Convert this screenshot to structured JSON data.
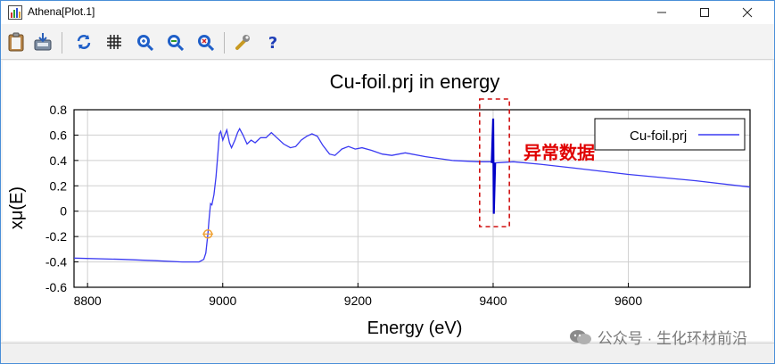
{
  "window": {
    "title": "Athena[Plot.1]"
  },
  "title_controls": {
    "minimize_icon": "minimize-icon",
    "maximize_icon": "maximize-icon",
    "close_icon": "close-icon"
  },
  "toolbar": {
    "buttons": [
      {
        "name": "copy-button",
        "icon": "clipboard-icon"
      },
      {
        "name": "save-button",
        "icon": "save-icon"
      },
      {
        "name": "refresh-button",
        "icon": "refresh-icon"
      },
      {
        "name": "grid-button",
        "icon": "grid-icon"
      },
      {
        "name": "zoom-in-button",
        "icon": "zoom-in-icon"
      },
      {
        "name": "zoom-out-button",
        "icon": "zoom-out-icon"
      },
      {
        "name": "zoom-reset-button",
        "icon": "zoom-reset-icon"
      },
      {
        "name": "settings-button",
        "icon": "wrench-icon"
      },
      {
        "name": "help-button",
        "icon": "help-icon"
      }
    ]
  },
  "annotation": {
    "text": "异常数据",
    "color": "#e00000"
  },
  "watermark": {
    "text": "公众号 · 生化环材前沿"
  },
  "colors": {
    "series": "#3a3af2",
    "spike": "#0000c8",
    "marker": "#f0a030",
    "annotation": "#e00000"
  },
  "chart_data": {
    "type": "line",
    "title": "Cu-foil.prj in energy",
    "xlabel": "Energy (eV)",
    "ylabel": "xμ(E)",
    "xlim": [
      8780,
      9780
    ],
    "ylim": [
      -0.6,
      0.8
    ],
    "x_ticks": [
      8800,
      9000,
      9200,
      9400,
      9600
    ],
    "y_ticks": [
      -0.6,
      -0.4,
      -0.2,
      0,
      0.2,
      0.4,
      0.6,
      0.8
    ],
    "grid": true,
    "legend": {
      "position": "top-right",
      "entries": [
        "Cu-foil.prj"
      ]
    },
    "series": [
      {
        "name": "Cu-foil.prj",
        "points": [
          [
            8780,
            -0.37
          ],
          [
            8850,
            -0.38
          ],
          [
            8900,
            -0.39
          ],
          [
            8940,
            -0.4
          ],
          [
            8965,
            -0.4
          ],
          [
            8972,
            -0.38
          ],
          [
            8975,
            -0.33
          ],
          [
            8978,
            -0.18
          ],
          [
            8980,
            -0.05
          ],
          [
            8982,
            0.06
          ],
          [
            8984,
            0.05
          ],
          [
            8987,
            0.13
          ],
          [
            8990,
            0.27
          ],
          [
            8993,
            0.47
          ],
          [
            8995,
            0.61
          ],
          [
            8997,
            0.63
          ],
          [
            9000,
            0.56
          ],
          [
            9003,
            0.6
          ],
          [
            9006,
            0.64
          ],
          [
            9010,
            0.54
          ],
          [
            9013,
            0.5
          ],
          [
            9018,
            0.56
          ],
          [
            9022,
            0.62
          ],
          [
            9025,
            0.65
          ],
          [
            9030,
            0.6
          ],
          [
            9036,
            0.53
          ],
          [
            9042,
            0.56
          ],
          [
            9048,
            0.54
          ],
          [
            9056,
            0.58
          ],
          [
            9064,
            0.58
          ],
          [
            9072,
            0.62
          ],
          [
            9080,
            0.58
          ],
          [
            9090,
            0.53
          ],
          [
            9100,
            0.5
          ],
          [
            9108,
            0.51
          ],
          [
            9116,
            0.56
          ],
          [
            9124,
            0.59
          ],
          [
            9132,
            0.61
          ],
          [
            9140,
            0.59
          ],
          [
            9148,
            0.52
          ],
          [
            9158,
            0.45
          ],
          [
            9166,
            0.44
          ],
          [
            9176,
            0.49
          ],
          [
            9186,
            0.51
          ],
          [
            9196,
            0.49
          ],
          [
            9206,
            0.5
          ],
          [
            9220,
            0.48
          ],
          [
            9236,
            0.45
          ],
          [
            9250,
            0.44
          ],
          [
            9270,
            0.46
          ],
          [
            9300,
            0.43
          ],
          [
            9340,
            0.4
          ],
          [
            9380,
            0.39
          ],
          [
            9396,
            0.39
          ],
          [
            9400,
            0.38
          ],
          [
            9430,
            0.39
          ],
          [
            9470,
            0.37
          ],
          [
            9520,
            0.34
          ],
          [
            9600,
            0.29
          ],
          [
            9700,
            0.24
          ],
          [
            9780,
            0.19
          ]
        ]
      }
    ],
    "anomaly": {
      "x": [
        9398,
        9400,
        9401,
        9403
      ],
      "y": [
        0.38,
        0.73,
        -0.02,
        0.38
      ]
    },
    "marker": {
      "x": 8978,
      "y": -0.18
    }
  }
}
